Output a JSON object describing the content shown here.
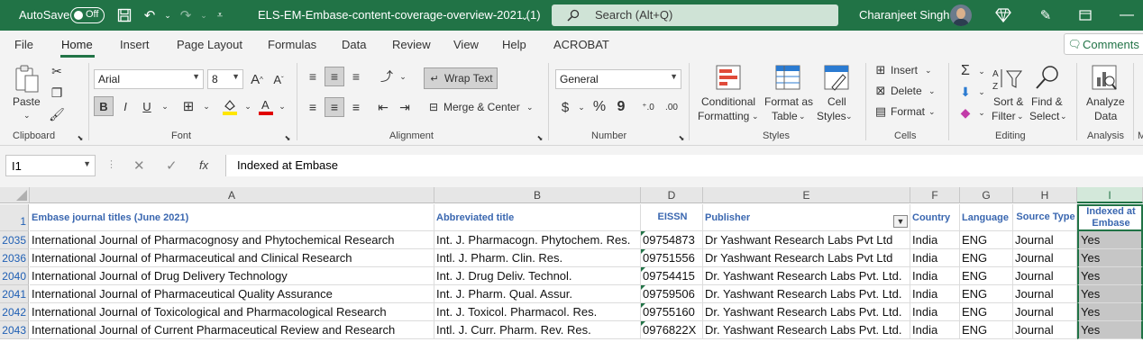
{
  "titlebar": {
    "autosave_label": "AutoSave",
    "autosave_state": "Off",
    "filename": "ELS-EM-Embase-content-coverage-overview-2021 (1)",
    "search_placeholder": "Search (Alt+Q)",
    "user_name": "Charanjeet Singh"
  },
  "menu": {
    "tabs": [
      "File",
      "Home",
      "Insert",
      "Page Layout",
      "Formulas",
      "Data",
      "Review",
      "View",
      "Help",
      "ACROBAT"
    ],
    "active_tab": "Home",
    "comments_label": "Comments"
  },
  "ribbon": {
    "clipboard": {
      "paste": "Paste",
      "label": "Clipboard"
    },
    "font": {
      "name": "Arial",
      "size": "8",
      "label": "Font",
      "bold": "B",
      "italic": "I",
      "underline": "U"
    },
    "alignment": {
      "wrap_text": "Wrap Text",
      "merge_center": "Merge & Center",
      "label": "Alignment"
    },
    "number": {
      "format": "General",
      "label": "Number",
      "currency": "$",
      "percent": "%",
      "comma": "9"
    },
    "styles": {
      "conditional_1": "Conditional",
      "conditional_2": "Formatting",
      "format_table_1": "Format as",
      "format_table_2": "Table",
      "cell_styles_1": "Cell",
      "cell_styles_2": "Styles",
      "label": "Styles"
    },
    "cells": {
      "insert": "Insert",
      "delete": "Delete",
      "format": "Format",
      "label": "Cells"
    },
    "editing": {
      "sort_1": "Sort &",
      "sort_2": "Filter",
      "find_1": "Find &",
      "find_2": "Select",
      "label": "Editing"
    },
    "analysis": {
      "analyze_1": "Analyze",
      "analyze_2": "Data",
      "label": "Analysis"
    },
    "colors": {
      "highlight": "#ffe600",
      "font_color": "#e00000",
      "accent": "#217346"
    }
  },
  "formula_bar": {
    "name_box": "I1",
    "fx": "fx",
    "content": "Indexed at Embase"
  },
  "grid": {
    "columns": [
      "A",
      "B",
      "D",
      "E",
      "F",
      "G",
      "H",
      "I"
    ],
    "header_row": {
      "row_num": "1",
      "cells": [
        "Embase journal titles (June 2021)",
        "Abbreviated title",
        "EISSN",
        "Publisher",
        "Country",
        "Language",
        "Source Type",
        "Indexed at Embase"
      ]
    },
    "rows": [
      {
        "row_num": "2035",
        "cells": [
          "International Journal of Pharmacognosy and Phytochemical Research",
          "Int. J. Pharmacogn. Phytochem. Res.",
          "09754873",
          "Dr Yashwant Research Labs Pvt Ltd",
          "India",
          "ENG",
          "Journal",
          "Yes"
        ]
      },
      {
        "row_num": "2036",
        "cells": [
          "International Journal of Pharmaceutical and Clinical Research",
          "Intl. J. Pharm. Clin. Res.",
          "09751556",
          "Dr Yashwant Research Labs Pvt Ltd",
          "India",
          "ENG",
          "Journal",
          "Yes"
        ]
      },
      {
        "row_num": "2040",
        "cells": [
          "International Journal of Drug Delivery Technology",
          "Int. J. Drug Deliv. Technol.",
          "09754415",
          "Dr. Yashwant Research Labs Pvt. Ltd.",
          "India",
          "ENG",
          "Journal",
          "Yes"
        ]
      },
      {
        "row_num": "2041",
        "cells": [
          "International Journal of Pharmaceutical Quality Assurance",
          "Int. J. Pharm. Qual. Assur.",
          "09759506",
          "Dr. Yashwant Research Labs Pvt. Ltd.",
          "India",
          "ENG",
          "Journal",
          "Yes"
        ]
      },
      {
        "row_num": "2042",
        "cells": [
          "International Journal of Toxicological and Pharmacological Research",
          "Int. J. Toxicol. Pharmacol. Res.",
          "09755160",
          "Dr. Yashwant Research Labs Pvt. Ltd.",
          "India",
          "ENG",
          "Journal",
          "Yes"
        ]
      },
      {
        "row_num": "2043",
        "cells": [
          "International Journal of Current Pharmaceutical Review and Research",
          "Intl. J. Curr. Pharm. Rev. Res.",
          "0976822X",
          "Dr. Yashwant Research Labs Pvt. Ltd.",
          "India",
          "ENG",
          "Journal",
          "Yes"
        ]
      }
    ]
  }
}
